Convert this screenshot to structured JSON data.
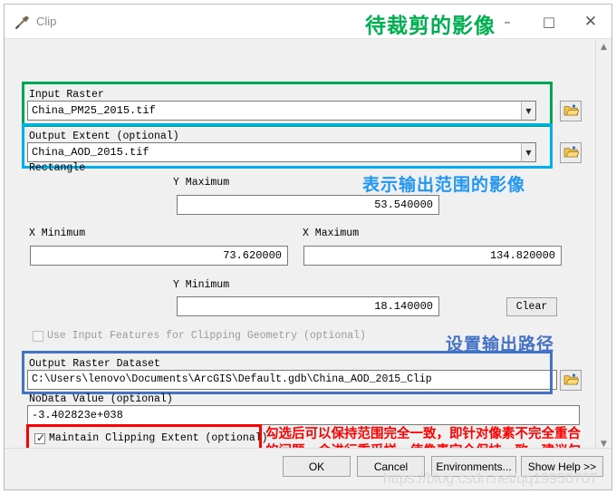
{
  "window": {
    "title": "Clip",
    "icon": "hammer-icon",
    "minimize_label": "–",
    "maximize_label": "□",
    "close_label": "✕"
  },
  "annotations": {
    "title_green": "待裁剪的影像",
    "extent_blue": "表示输出范围的影像",
    "output_path_blue": "设置输出路径",
    "maintain_red": "勾选后可以保持范围完全一致，即针对像素不完全重合的问题，会进行重采样，使像素完全保持一致，建议勾选，这样才能完全匹配",
    "colors": {
      "green": "#00b050",
      "cyan": "#2196f3",
      "blue": "#4472c4",
      "red": "#fe0000"
    }
  },
  "form": {
    "input_raster": {
      "label": "Input Raster",
      "value": "China_PM25_2015.tif",
      "browse_icon": "folder-open-icon",
      "dropdown_icon": "chevron-down-icon"
    },
    "output_extent": {
      "label": "Output Extent (optional)",
      "value": "China_AOD_2015.tif",
      "browse_icon": "folder-open-icon",
      "dropdown_icon": "chevron-down-icon"
    },
    "rectangle": {
      "label": "Rectangle",
      "y_maximum": {
        "label": "Y Maximum",
        "value": "53.540000"
      },
      "x_minimum": {
        "label": "X Minimum",
        "value": "73.620000"
      },
      "x_maximum": {
        "label": "X Maximum",
        "value": "134.820000"
      },
      "y_minimum": {
        "label": "Y Minimum",
        "value": "18.140000"
      },
      "clear_button": "Clear"
    },
    "use_input_features": {
      "label": "Use Input Features for Clipping Geometry (optional)",
      "checked": false,
      "enabled": false
    },
    "output_raster_dataset": {
      "label": "Output Raster Dataset",
      "value": "C:\\Users\\lenovo\\Documents\\ArcGIS\\Default.gdb\\China_AOD_2015_Clip",
      "browse_icon": "folder-open-icon"
    },
    "nodata_value": {
      "label": "NoData Value (optional)",
      "value": "-3.402823e+038"
    },
    "maintain_clipping_extent": {
      "label": "Maintain Clipping Extent (optional)",
      "checked": true,
      "check_glyph": "✓"
    }
  },
  "footer": {
    "ok": "OK",
    "cancel": "Cancel",
    "environments": "Environments...",
    "show_help": "Show Help >>",
    "watermark": "https://blog.csdn.net/qq19950707"
  }
}
